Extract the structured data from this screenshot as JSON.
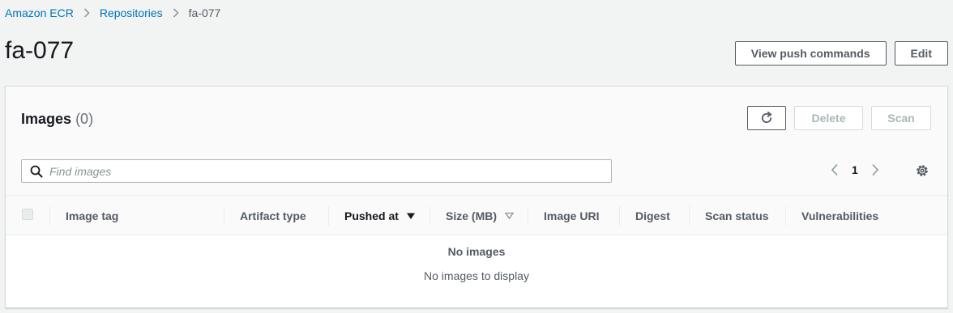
{
  "breadcrumb": {
    "items": [
      {
        "label": "Amazon ECR"
      },
      {
        "label": "Repositories"
      },
      {
        "label": "fa-077"
      }
    ]
  },
  "page": {
    "title": "fa-077",
    "actions": {
      "view_push_commands": "View push commands",
      "edit": "Edit"
    }
  },
  "images_panel": {
    "title": "Images",
    "count": "(0)",
    "actions": {
      "refresh_icon": "refresh-icon",
      "delete": "Delete",
      "scan": "Scan"
    },
    "search": {
      "value": "",
      "placeholder": "Find images"
    },
    "pagination": {
      "current_page": "1"
    },
    "columns": [
      "Image tag",
      "Artifact type",
      "Pushed at",
      "Size (MB)",
      "Image URI",
      "Digest",
      "Scan status",
      "Vulnerabilities"
    ],
    "empty": {
      "title": "No images",
      "description": "No images to display"
    }
  },
  "colors": {
    "link": "#0073bb",
    "background": "#f2f3f3",
    "text": "#16191f",
    "muted": "#545b64"
  }
}
